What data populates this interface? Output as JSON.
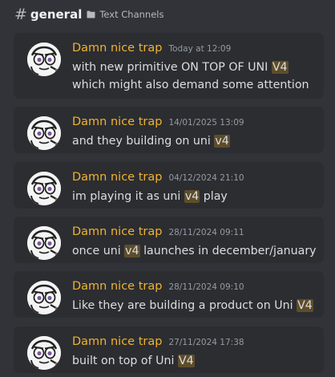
{
  "header": {
    "hash_symbol": "#",
    "channel_name": "general",
    "category_name": "Text Channels",
    "icons": {
      "channel": "hash-icon",
      "category": "folder-icon"
    }
  },
  "colors": {
    "background": "#313338",
    "card_background": "#2b2d31",
    "author": "#f0b232",
    "timestamp": "#949ba4",
    "text": "#dbdee1",
    "highlight": "#5e4d2a"
  },
  "results": [
    {
      "author": "Damn nice trap",
      "timestamp": "Today at 12:09",
      "avatar_icon": "user-avatar-icon",
      "lines": [
        {
          "before": "with new primitive ON TOP OF UNI ",
          "highlight": "V4",
          "after": ""
        },
        {
          "before": "which might also demand some attention",
          "highlight": "",
          "after": ""
        }
      ]
    },
    {
      "author": "Damn nice trap",
      "timestamp": "14/01/2025 13:09",
      "avatar_icon": "user-avatar-icon",
      "lines": [
        {
          "before": "and they building on uni ",
          "highlight": "v4",
          "after": ""
        }
      ]
    },
    {
      "author": "Damn nice trap",
      "timestamp": "04/12/2024 21:10",
      "avatar_icon": "user-avatar-icon",
      "lines": [
        {
          "before": "im playing it as uni ",
          "highlight": "v4",
          "after": " play"
        }
      ]
    },
    {
      "author": "Damn nice trap",
      "timestamp": "28/11/2024 09:11",
      "avatar_icon": "user-avatar-icon",
      "lines": [
        {
          "before": "once uni ",
          "highlight": "v4",
          "after": " launches in december/january"
        }
      ]
    },
    {
      "author": "Damn nice trap",
      "timestamp": "28/11/2024 09:10",
      "avatar_icon": "user-avatar-icon",
      "lines": [
        {
          "before": "Like they are building a product on Uni ",
          "highlight": "V4",
          "after": ""
        }
      ]
    },
    {
      "author": "Damn nice trap",
      "timestamp": "27/11/2024 17:38",
      "avatar_icon": "user-avatar-icon",
      "lines": [
        {
          "before": "built on top of Uni ",
          "highlight": "V4",
          "after": ""
        }
      ]
    }
  ]
}
